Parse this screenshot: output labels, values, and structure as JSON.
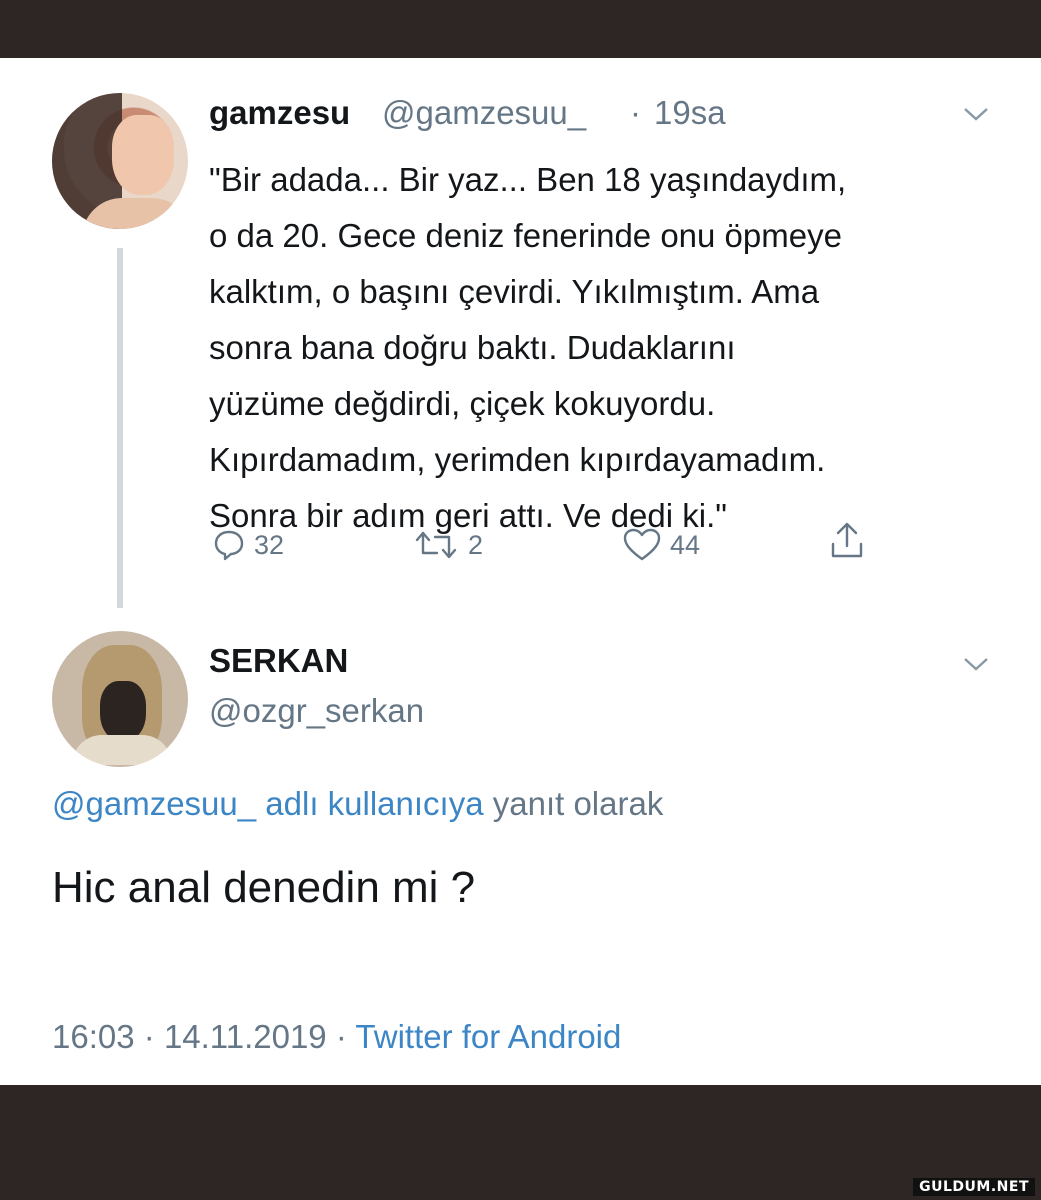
{
  "tweet": {
    "author_name": "gamzesu",
    "author_handle": "@gamzesuu_",
    "separator": "·",
    "age": "19sa",
    "text": "\"Bir adada... Bir yaz... Ben 18 yaşındaydım,\no da 20. Gece deniz fenerinde onu öpmeye\nkalktım, o başını çevirdi. Yıkılmıştım. Ama\nsonra bana doğru baktı. Dudaklarını\nyüzüme değdirdi, çiçek kokuyordu.\nKıpırdamadım, yerimden kıpırdayamadım.\nSonra bir adım geri attı. Ve dedi ki.\"",
    "replies": "32",
    "retweets": "2",
    "likes": "44",
    "icons": [
      "reply-icon",
      "retweet-icon",
      "like-icon",
      "share-icon",
      "chevron-down-icon"
    ]
  },
  "reply": {
    "author_name": "SERKAN",
    "author_handle": "@ozgr_serkan",
    "reply_to_link": "@gamzesuu_ adlı kullanıcıya",
    "reply_to_rest": "yanıt olarak",
    "text": "Hic anal denedin mi ?",
    "time": "16:03",
    "separator1": "·",
    "date": "14.11.2019",
    "separator2": "·",
    "source": "Twitter for Android"
  },
  "watermark": "GULDUM.NET",
  "colors": {
    "frame": "#2e2624",
    "text": "#14171a",
    "muted": "#657786",
    "link": "#3d86c6"
  }
}
